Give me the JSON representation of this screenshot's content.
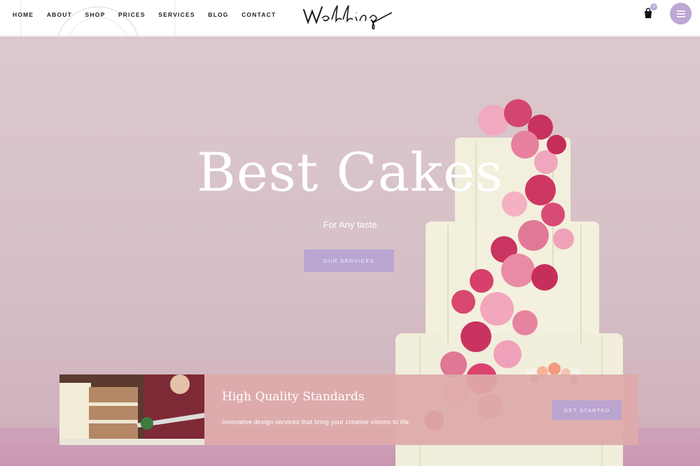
{
  "nav": {
    "items": [
      {
        "label": "HOME"
      },
      {
        "label": "ABOUT"
      },
      {
        "label": "SHOP"
      },
      {
        "label": "PRICES"
      },
      {
        "label": "SERVICES"
      },
      {
        "label": "BLOG"
      },
      {
        "label": "CONTACT"
      }
    ]
  },
  "logo": {
    "text": "Wedding"
  },
  "cart": {
    "count": "0",
    "icon": "shopping-bag-icon"
  },
  "menu": {
    "icon": "hamburger-menu-icon"
  },
  "hero": {
    "title": "Best Cakes",
    "subtitle": "For Any taste",
    "button_label": "OUR SERVICES"
  },
  "banner": {
    "title": "High Quality Standards",
    "text": "Innovative design services that bring your creative visions to life.",
    "button_label": "GET STARTED"
  },
  "colors": {
    "accent": "#b9a6d3",
    "banner_bg": "#dea9a9",
    "hero_bg": "#d8c3c8"
  }
}
